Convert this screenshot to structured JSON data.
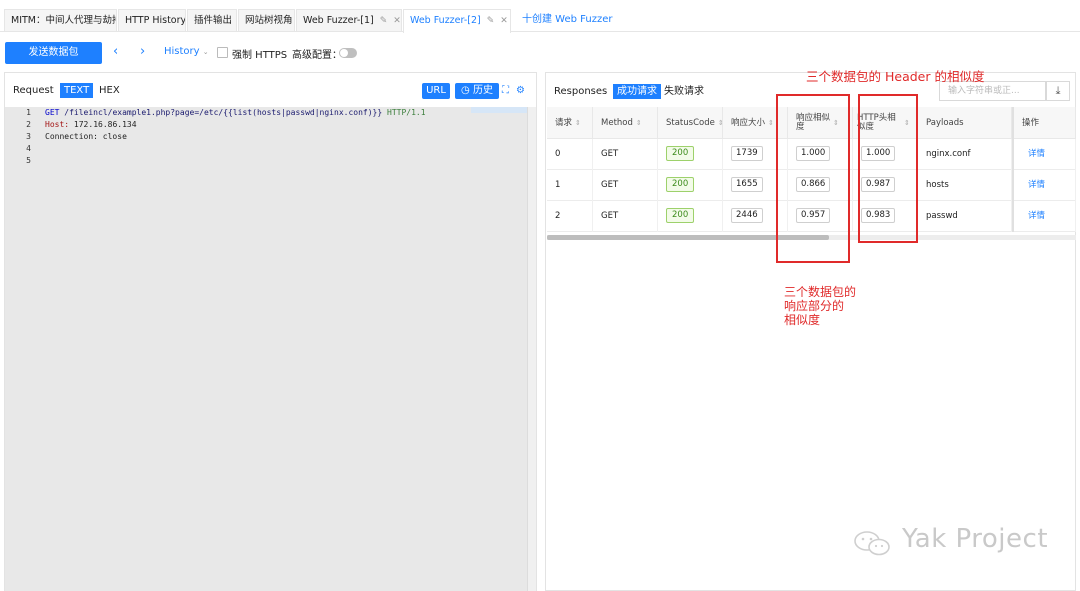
{
  "tabs": [
    {
      "label": "MITM：中间人代理与劫持"
    },
    {
      "label": "HTTP History"
    },
    {
      "label": "插件输出"
    },
    {
      "label": "网站树视角"
    },
    {
      "label": "Web Fuzzer-[1]"
    },
    {
      "label": "Web Fuzzer-[2]"
    }
  ],
  "new_tab_label": "十创建 Web Fuzzer",
  "toolbar": {
    "send_label": "发送数据包",
    "history_label": "History",
    "force_https_label": "强制 HTTPS",
    "advanced_label": "高级配置："
  },
  "request": {
    "title": "Request",
    "mode_text": "TEXT",
    "mode_hex": "HEX",
    "url_btn": "URL",
    "history_btn": "历史",
    "line_numbers": [
      "1",
      "2",
      "3",
      "4",
      "5"
    ],
    "line1_method": "GET",
    "line1_path": "/fileincl/example1.php?page=/etc/{{list(hosts|passwd|nginx.conf)}}",
    "line1_proto": "HTTP/1.1",
    "line2_key": "Host:",
    "line2_val": "172.16.86.134",
    "line3": "Connection: close"
  },
  "responses": {
    "title": "Responses",
    "tab_success": "成功请求",
    "tab_failed": "失败请求",
    "search_placeholder": "输入字符串或正...",
    "headers": [
      "请求",
      "Method",
      "StatusCode",
      "响应大小",
      "响应相似度",
      "HTTP头相似度",
      "Payloads",
      "操作"
    ],
    "rows": [
      {
        "id": "0",
        "method": "GET",
        "status": "200",
        "size": "1739",
        "body_sim": "1.000",
        "header_sim": "1.000",
        "payload": "nginx.conf",
        "action": "详情"
      },
      {
        "id": "1",
        "method": "GET",
        "status": "200",
        "size": "1655",
        "body_sim": "0.866",
        "header_sim": "0.987",
        "payload": "hosts",
        "action": "详情"
      },
      {
        "id": "2",
        "method": "GET",
        "status": "200",
        "size": "2446",
        "body_sim": "0.957",
        "header_sim": "0.983",
        "payload": "passwd",
        "action": "详情"
      }
    ]
  },
  "annotations": {
    "header_note": "三个数据包的 Header 的相似度",
    "body_note_line1": "三个数据包的",
    "body_note_line2": "响应部分的",
    "body_note_line3": "相似度"
  },
  "watermark": "Yak Project",
  "colors": {
    "accent": "#1e80ff",
    "annotation": "#e02a2a",
    "status_ok": "#3d8c1c"
  }
}
